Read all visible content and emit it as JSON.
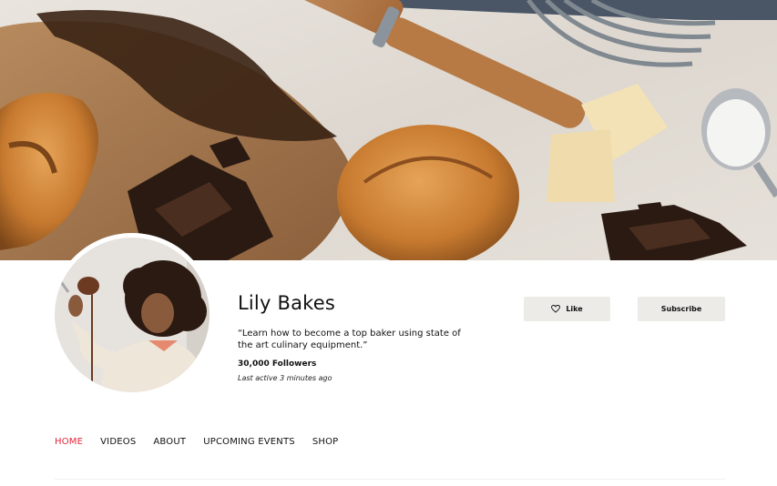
{
  "profile": {
    "name": "Lily Bakes",
    "bio": "“Learn how to become a top baker using state of the art culinary equipment.”",
    "followers": "30,000 Followers",
    "last_active": "Last active 3 minutes ago"
  },
  "actions": {
    "like_label": "Like",
    "subscribe_label": "Subscribe",
    "like_icon": "heart-icon"
  },
  "nav": {
    "tabs": [
      {
        "label": "HOME",
        "active": true
      },
      {
        "label": "VIDEOS",
        "active": false
      },
      {
        "label": "ABOUT",
        "active": false
      },
      {
        "label": "UPCOMING EVENTS",
        "active": false
      },
      {
        "label": "SHOP",
        "active": false
      }
    ]
  },
  "colors": {
    "accent": "#e0263a",
    "button_bg": "#ecebe7"
  }
}
